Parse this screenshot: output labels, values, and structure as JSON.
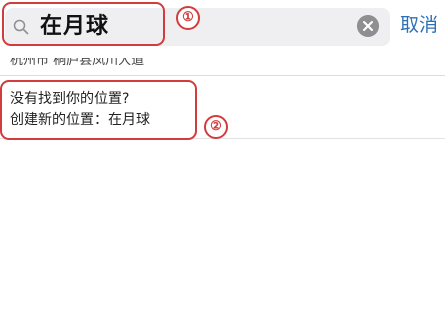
{
  "search": {
    "query": "在月球",
    "cancel_label": "取消"
  },
  "suggestions": {
    "partial_address": "杭州市 桐庐县凤川大道",
    "not_found_title": "没有找到你的位置?",
    "create_prefix": "创建新的位置：",
    "create_value": "在月球"
  },
  "annotations": {
    "marker_1": "①",
    "marker_2": "②"
  },
  "colors": {
    "annotation": "#d23c3c",
    "cancel": "#2f6fb6",
    "field_bg": "#efeff1"
  }
}
